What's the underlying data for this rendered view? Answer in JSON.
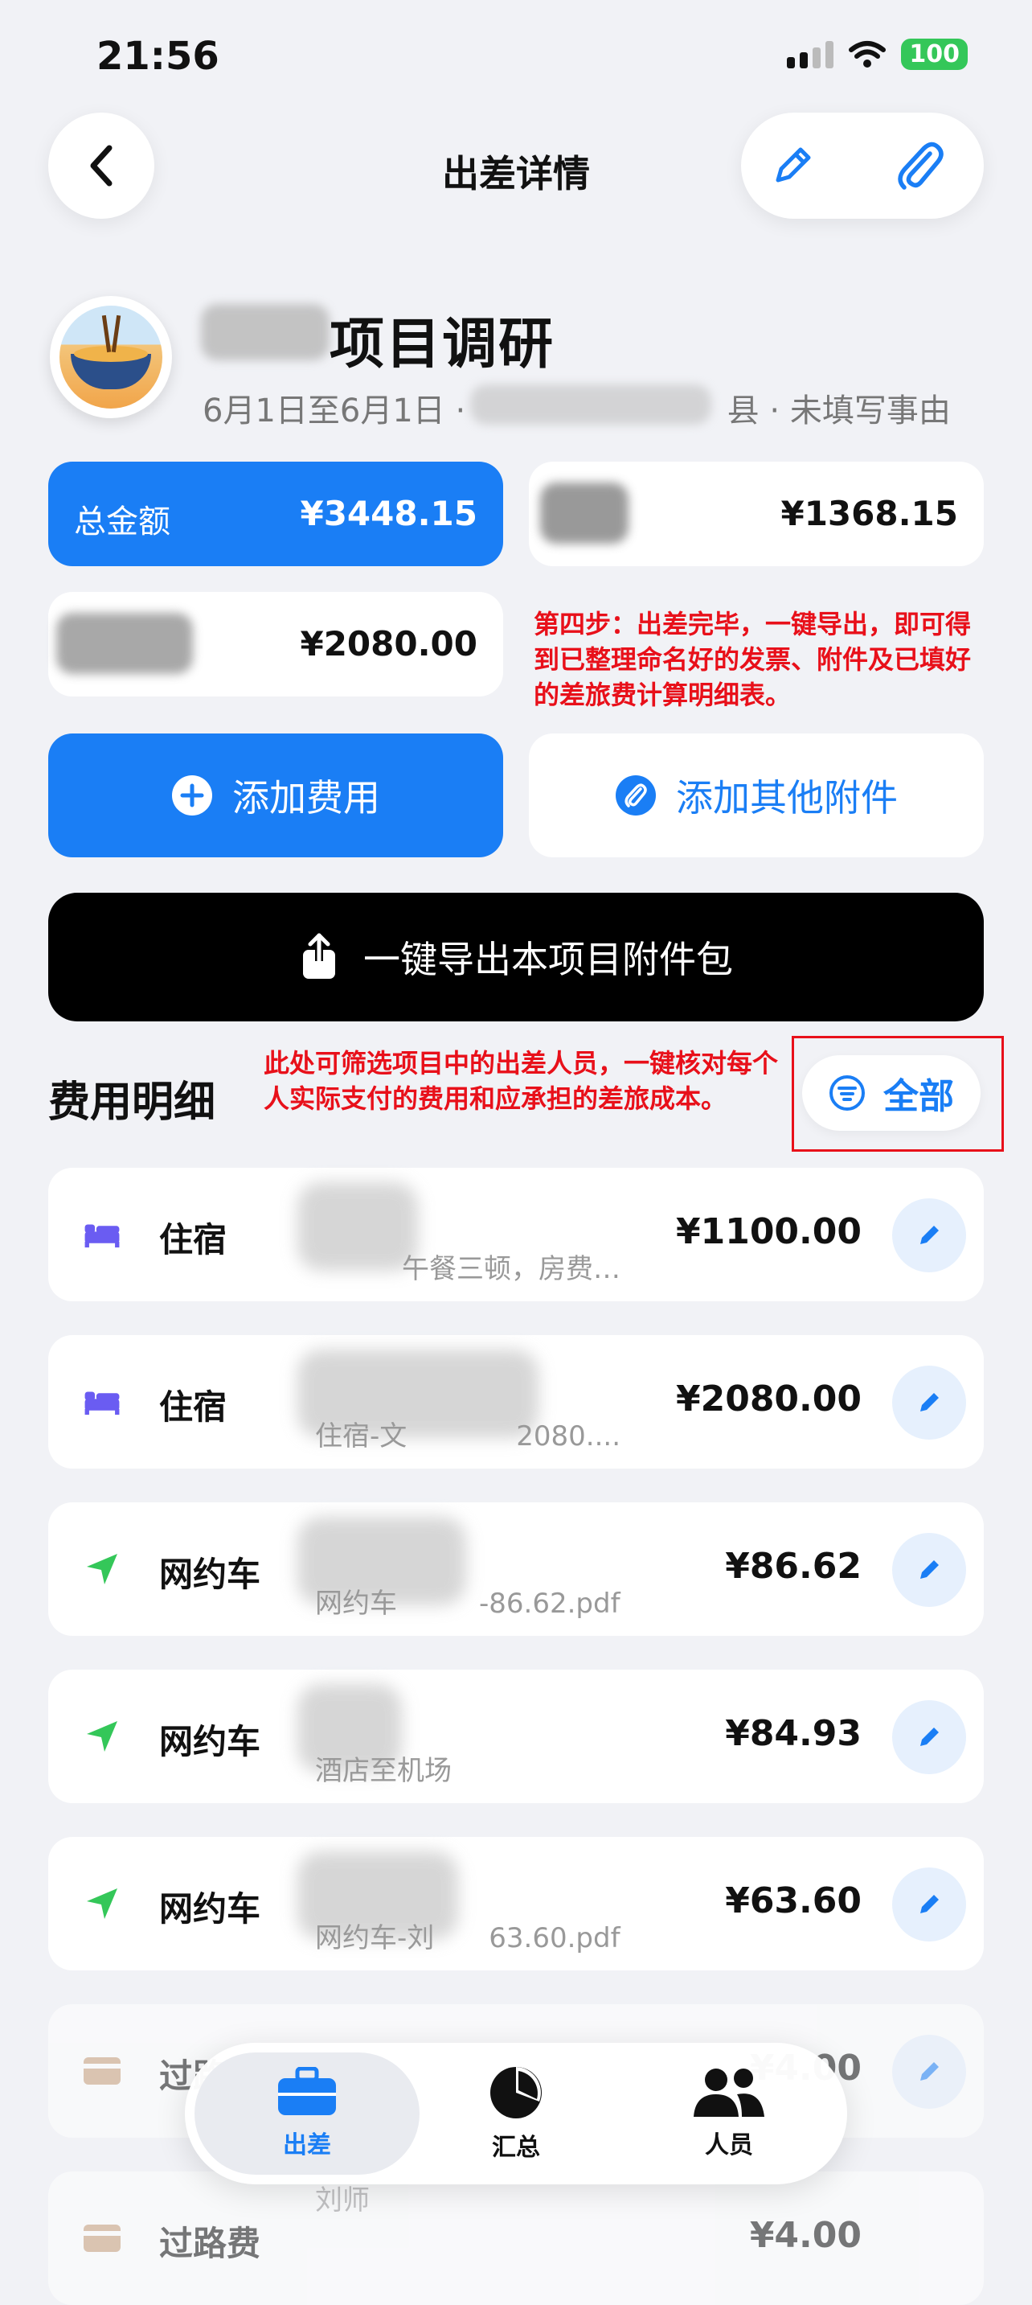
{
  "status_bar": {
    "time": "21:56",
    "battery": "100"
  },
  "nav": {
    "title": "出差详情"
  },
  "project": {
    "title": "项目调研",
    "subtitle_date": "6月1日至6月1日 ·",
    "subtitle_suffix": "县 · 未填写事由"
  },
  "summary": {
    "total_label": "总金额",
    "total_value": "¥3448.15",
    "card2_value": "¥1368.15",
    "card3_value": "¥2080.00",
    "note_step4": "第四步：出差完毕，一键导出，即可得到已整理命名好的发票、附件及已填好的差旅费计算明细表。"
  },
  "actions": {
    "add_expense": "添加费用",
    "add_attachment": "添加其他附件",
    "export": "一键导出本项目附件包"
  },
  "details": {
    "title": "费用明细",
    "note_filter": "此处可筛选项目中的出差人员，一键核对每个人实际支付的费用和应承担的差旅成本。",
    "filter_label": "全部"
  },
  "expenses": [
    {
      "type": "住宿",
      "icon": "bed-icon",
      "desc": "午餐三顿，房费…",
      "amount": "¥1100.00"
    },
    {
      "type": "住宿",
      "icon": "bed-icon",
      "desc": "住宿-文　　　　2080....",
      "amount": "¥2080.00"
    },
    {
      "type": "网约车",
      "icon": "navigation-arrow-icon",
      "desc": "网约车　　　-86.62.pdf",
      "amount": "¥86.62"
    },
    {
      "type": "网约车",
      "icon": "navigation-arrow-icon",
      "desc": "酒店至机场",
      "amount": "¥84.93"
    },
    {
      "type": "网约车",
      "icon": "navigation-arrow-icon",
      "desc": "网约车-刘　　63.60.pdf",
      "amount": "¥63.60"
    },
    {
      "type": "过路费",
      "icon": "card-icon",
      "desc": "",
      "amount": "¥4.00"
    },
    {
      "type": "过路费",
      "icon": "card-icon",
      "desc": "刘师",
      "amount": "¥4.00"
    }
  ],
  "tabs": [
    {
      "label": "出差",
      "icon": "briefcase-icon"
    },
    {
      "label": "汇总",
      "icon": "pie-chart-icon"
    },
    {
      "label": "人员",
      "icon": "people-icon"
    }
  ],
  "colors": {
    "accent": "#1a7ef5",
    "annotation": "#e8101a",
    "green": "#34c759",
    "purple": "#6a5cf2"
  }
}
